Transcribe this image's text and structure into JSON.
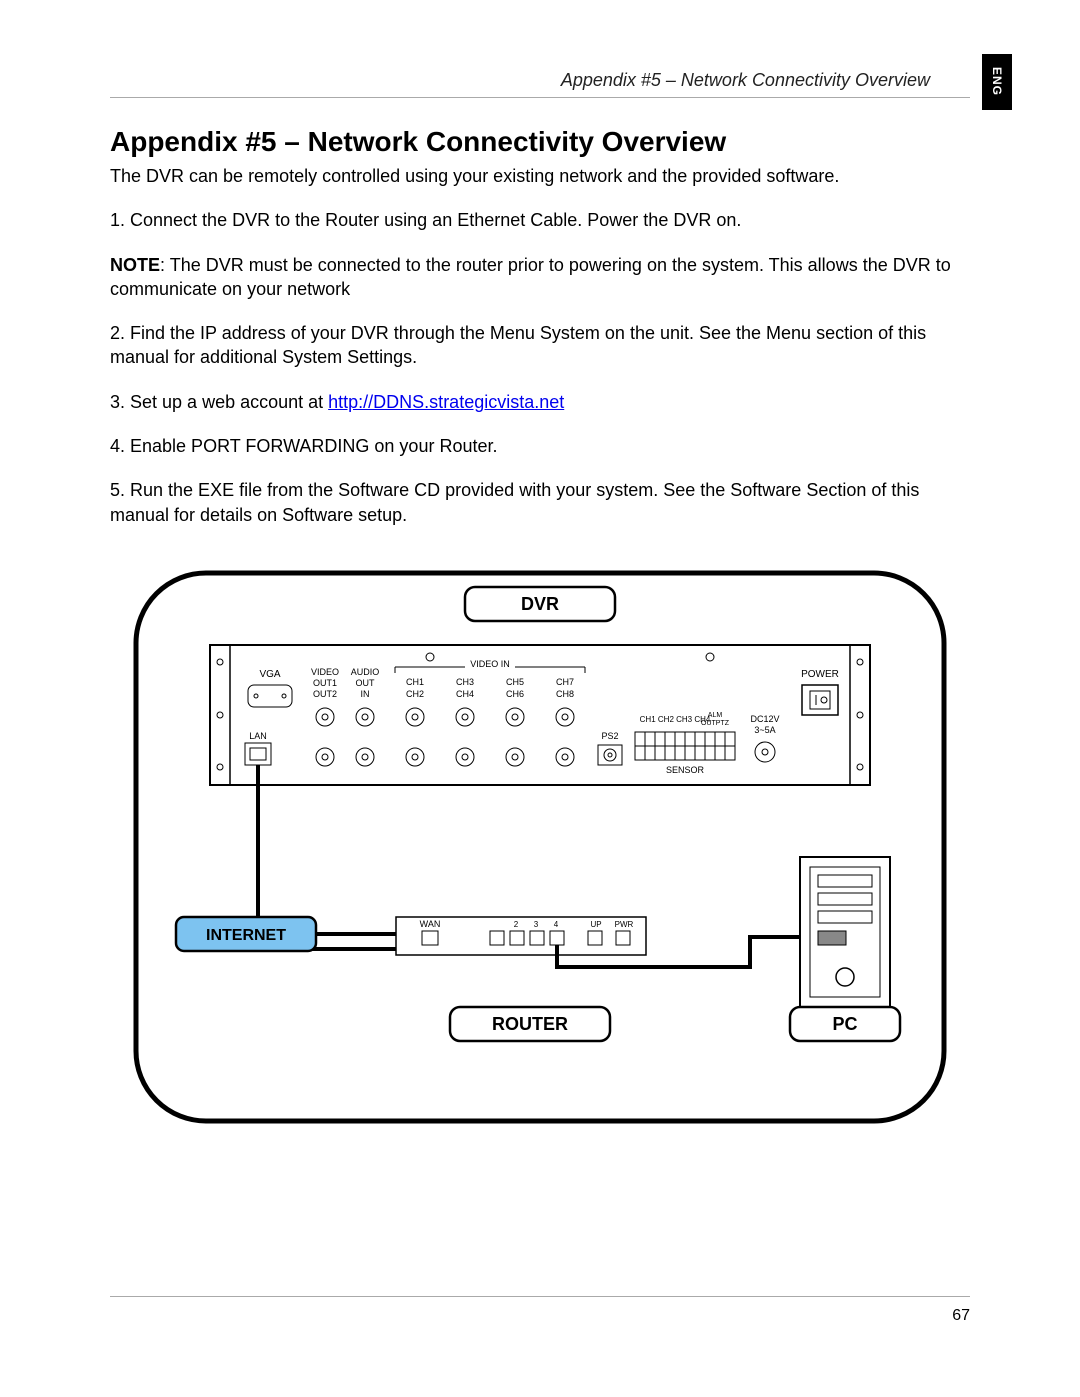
{
  "header": {
    "running_title": "Appendix #5 – Network Connectivity Overview",
    "lang_tab": "ENG"
  },
  "title": "Appendix #5 – Network Connectivity Overview",
  "intro": "The DVR can be remotely controlled using your existing network and the provided software.",
  "steps": {
    "s1": "1. Connect the DVR to the Router using an Ethernet Cable. Power the DVR on.",
    "note_label": "NOTE",
    "note_body": ": The DVR must be connected to the router prior to powering on the system. This allows the DVR to communicate on your network",
    "s2": "2. Find the IP address of your DVR through the Menu System on the unit.  See the Menu section of this manual for additional System Settings.",
    "s3_pre": "3. Set up a web account at ",
    "s3_link": "http://DDNS.strategicvista.net",
    "s4": "4. Enable PORT FORWARDING on your Router.",
    "s5": "5. Run the EXE file from the Software CD provided with your system. See the Software Section of this manual for details on Software setup."
  },
  "diagram": {
    "dvr_label": "DVR",
    "internet_label": "INTERNET",
    "router_label": "ROUTER",
    "pc_label": "PC",
    "dvr_ports": {
      "vga": "VGA",
      "video_out1": "VIDEO",
      "video_out1b": "OUT1",
      "video_out2": "OUT2",
      "audio_out": "AUDIO",
      "audio_out2": "OUT",
      "audio_in": "IN",
      "video_in": "VIDEO IN",
      "ch1": "CH1",
      "ch2": "CH2",
      "ch3": "CH3",
      "ch4": "CH4",
      "ch5": "CH5",
      "ch6": "CH6",
      "ch7": "CH7",
      "ch8": "CH8",
      "lan": "LAN",
      "ps2": "PS2",
      "sensor": "SENSOR",
      "alm": "ALM",
      "outptz": "OUTPTZ",
      "chrow": "CH1 CH2 CH3 CH4",
      "dc12v": "DC12V",
      "amp": "3~5A",
      "power": "POWER"
    },
    "router_ports": {
      "wan": "WAN",
      "p2": "2",
      "p3": "3",
      "p4": "4",
      "up": "UP",
      "pwr": "PWR"
    }
  },
  "footer": {
    "page_number": "67"
  }
}
